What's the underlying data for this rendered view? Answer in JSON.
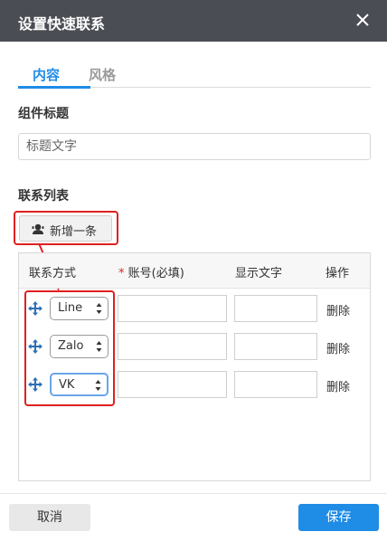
{
  "dialog": {
    "title": "设置快速联系"
  },
  "tabs": [
    {
      "label": "内容",
      "active": true
    },
    {
      "label": "风格",
      "active": false
    }
  ],
  "component_title": {
    "label": "组件标题",
    "input_placeholder": "标题文字"
  },
  "contact_list": {
    "label": "联系列表",
    "add_button_label": "新增一条"
  },
  "table": {
    "headers": {
      "method": "联系方式",
      "required_mark": "*",
      "account": "账号(必填)",
      "display_text": "显示文字",
      "action": "操作"
    },
    "rows": [
      {
        "method": "Line",
        "account": "",
        "display_text": "",
        "action": "删除"
      },
      {
        "method": "Zalo",
        "account": "",
        "display_text": "",
        "action": "删除"
      },
      {
        "method": "VK",
        "account": "",
        "display_text": "",
        "action": "删除"
      }
    ]
  },
  "footer": {
    "cancel_label": "取消",
    "save_label": "保存"
  },
  "colors": {
    "titlebar": "#4a4d53",
    "accent": "#1f8ce6",
    "annotation": "#e02020"
  }
}
